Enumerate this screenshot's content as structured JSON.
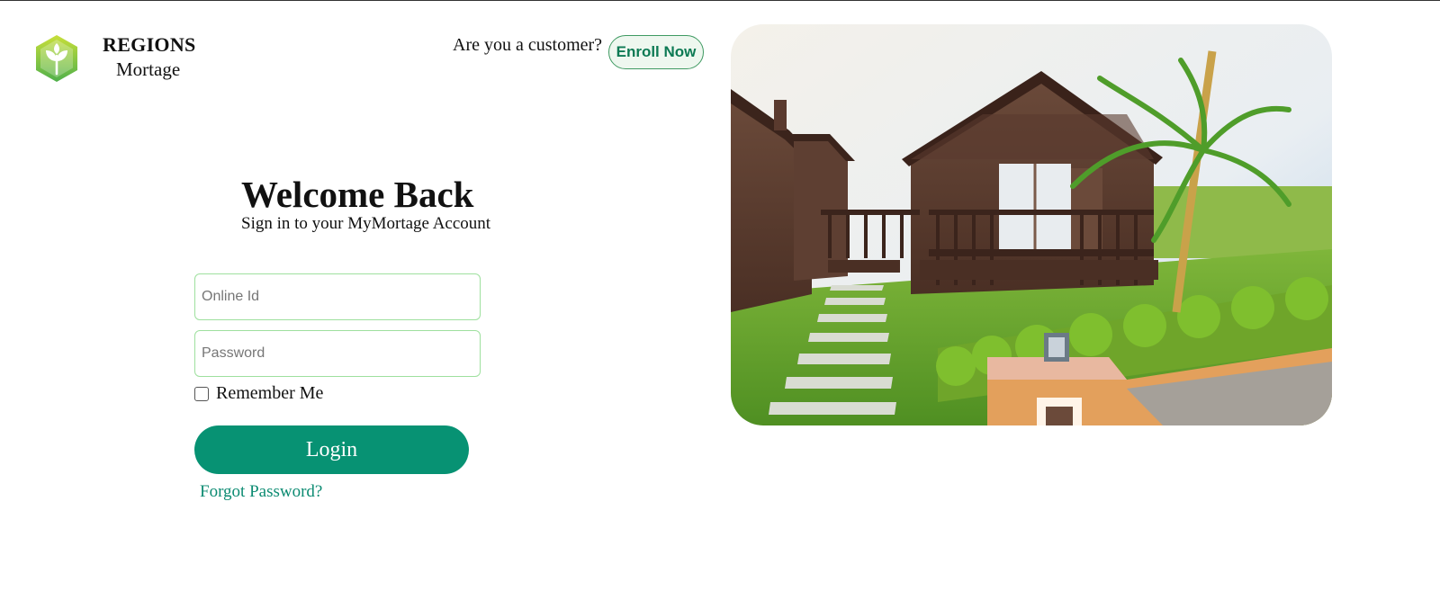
{
  "brand": {
    "name": "REGIONS",
    "subtitle": "Mortage"
  },
  "header": {
    "customer_question": "Are you a customer?",
    "enroll_label": "Enroll Now"
  },
  "login": {
    "title": "Welcome Back",
    "subtitle": "Sign in to your MyMortage Account",
    "online_id_placeholder": "Online Id",
    "online_id_value": "",
    "password_placeholder": "Password",
    "password_value": "",
    "remember_label": "Remember Me",
    "remember_checked": false,
    "login_label": "Login",
    "forgot_label": "Forgot Password?"
  },
  "colors": {
    "primary": "#079273",
    "link": "#0c8b72",
    "input_border": "#9ee09e",
    "logo_green": "#7cc142"
  },
  "icons": {
    "logo": "leaf-hexagon-icon"
  }
}
